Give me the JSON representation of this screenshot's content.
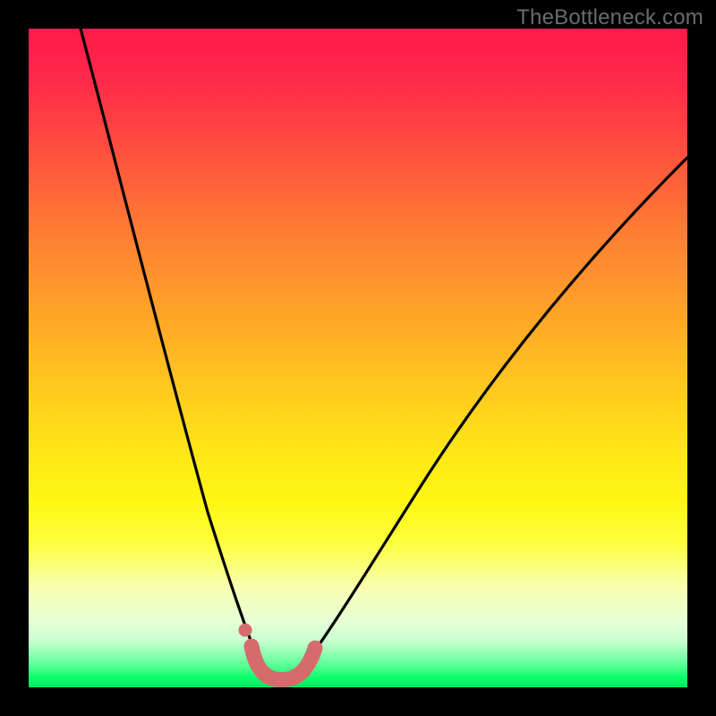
{
  "watermark": "TheBottleneck.com",
  "colors": {
    "frame": "#000000",
    "curve_stroke": "#000000",
    "marker_fill": "#d66b6b",
    "gradient_top": "#ff1a49",
    "gradient_bottom": "#00e85e"
  },
  "chart_data": {
    "type": "line",
    "title": "",
    "xlabel": "",
    "ylabel": "",
    "xlim": [
      0,
      100
    ],
    "ylim": [
      0,
      100
    ],
    "grid": false,
    "legend": false,
    "series": [
      {
        "name": "bottleneck-curve",
        "x": [
          8,
          10,
          12,
          14,
          16,
          18,
          20,
          22,
          24,
          26,
          28,
          30,
          32,
          33,
          34,
          35,
          36,
          37,
          38,
          40,
          42,
          45,
          48,
          52,
          56,
          60,
          65,
          70,
          75,
          80,
          85,
          90,
          95,
          100
        ],
        "y": [
          100,
          92,
          84,
          76,
          68,
          60,
          52,
          44,
          37,
          30,
          24,
          18,
          12,
          9,
          6,
          3.5,
          2,
          1.2,
          1,
          1.2,
          2,
          4,
          7,
          12,
          18,
          24,
          31,
          38,
          44,
          50,
          55,
          60,
          64,
          68
        ]
      }
    ],
    "minimum_band": {
      "x_start": 33,
      "x_end": 42,
      "y_approx": 1
    }
  }
}
